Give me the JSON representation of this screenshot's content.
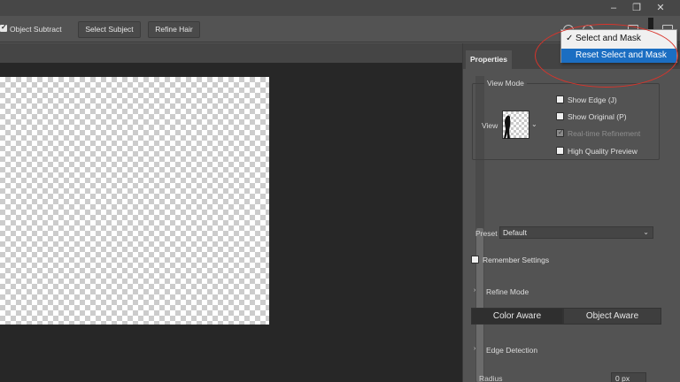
{
  "window": {
    "minimize_icon": "minimize-icon",
    "restore_icon": "restore-icon",
    "close_icon": "close-icon",
    "minimize_glyph": "–",
    "restore_glyph": "❐",
    "close_glyph": "✕"
  },
  "options_bar": {
    "object_subtract_label": "Object Subtract",
    "object_subtract_checked": true,
    "select_subject_label": "Select Subject",
    "refine_hair_label": "Refine Hair"
  },
  "menu": {
    "items": [
      {
        "label": "Select and Mask",
        "checked": true,
        "check_glyph": "✓"
      },
      {
        "label": "Reset Select and Mask",
        "selected": true
      }
    ]
  },
  "properties": {
    "tab_label": "Properties",
    "view_mode_title": "View Mode",
    "view_label": "View",
    "view_chevron": "⌄",
    "options": [
      {
        "label": "Show Edge (J)",
        "checked": false,
        "enabled": true
      },
      {
        "label": "Show Original (P)",
        "checked": false,
        "enabled": true
      },
      {
        "label": "Real-time Refinement",
        "checked": true,
        "enabled": false,
        "check_glyph": "✓"
      },
      {
        "label": "High Quality Preview",
        "checked": false,
        "enabled": true
      }
    ],
    "preset_label": "Preset",
    "preset_value": "Default",
    "preset_chevron": "⌄",
    "remember_settings_label": "Remember Settings",
    "section_chevron": "›",
    "refine_mode_title": "Refine Mode",
    "refine_modes": [
      "Color Aware",
      "Object Aware"
    ],
    "active_refine_mode": "Color Aware",
    "edge_detection_title": "Edge Detection",
    "radius_label": "Radius",
    "radius_value": "0 px"
  },
  "colors": {
    "menu_highlight": "#1b6ec2",
    "annotation": "#d9342b",
    "canvas": "#272727",
    "panel": "#535353"
  }
}
